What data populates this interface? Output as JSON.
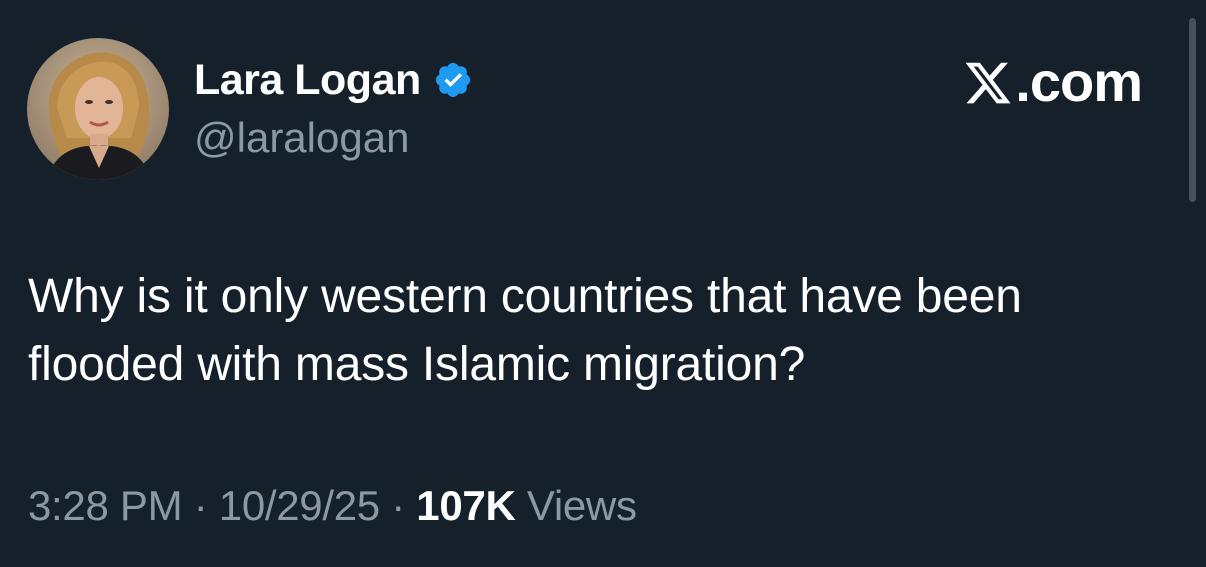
{
  "author": {
    "display_name": "Lara Logan",
    "handle": "@laralogan",
    "verified": true,
    "avatar_icon": "profile-photo"
  },
  "brand": {
    "domain": ".com",
    "logo_icon": "x-logo-icon"
  },
  "tweet": {
    "text": "Why is it only western countries that have been flooded with mass Islamic migration?"
  },
  "meta": {
    "time": "3:28 PM",
    "separator": "·",
    "date": "10/29/25",
    "views_count": "107K",
    "views_label": "Views"
  },
  "colors": {
    "background": "#16202b",
    "primary_text": "#ffffff",
    "secondary_text": "#8b98a5",
    "verified_badge": "#1d9bf0"
  }
}
